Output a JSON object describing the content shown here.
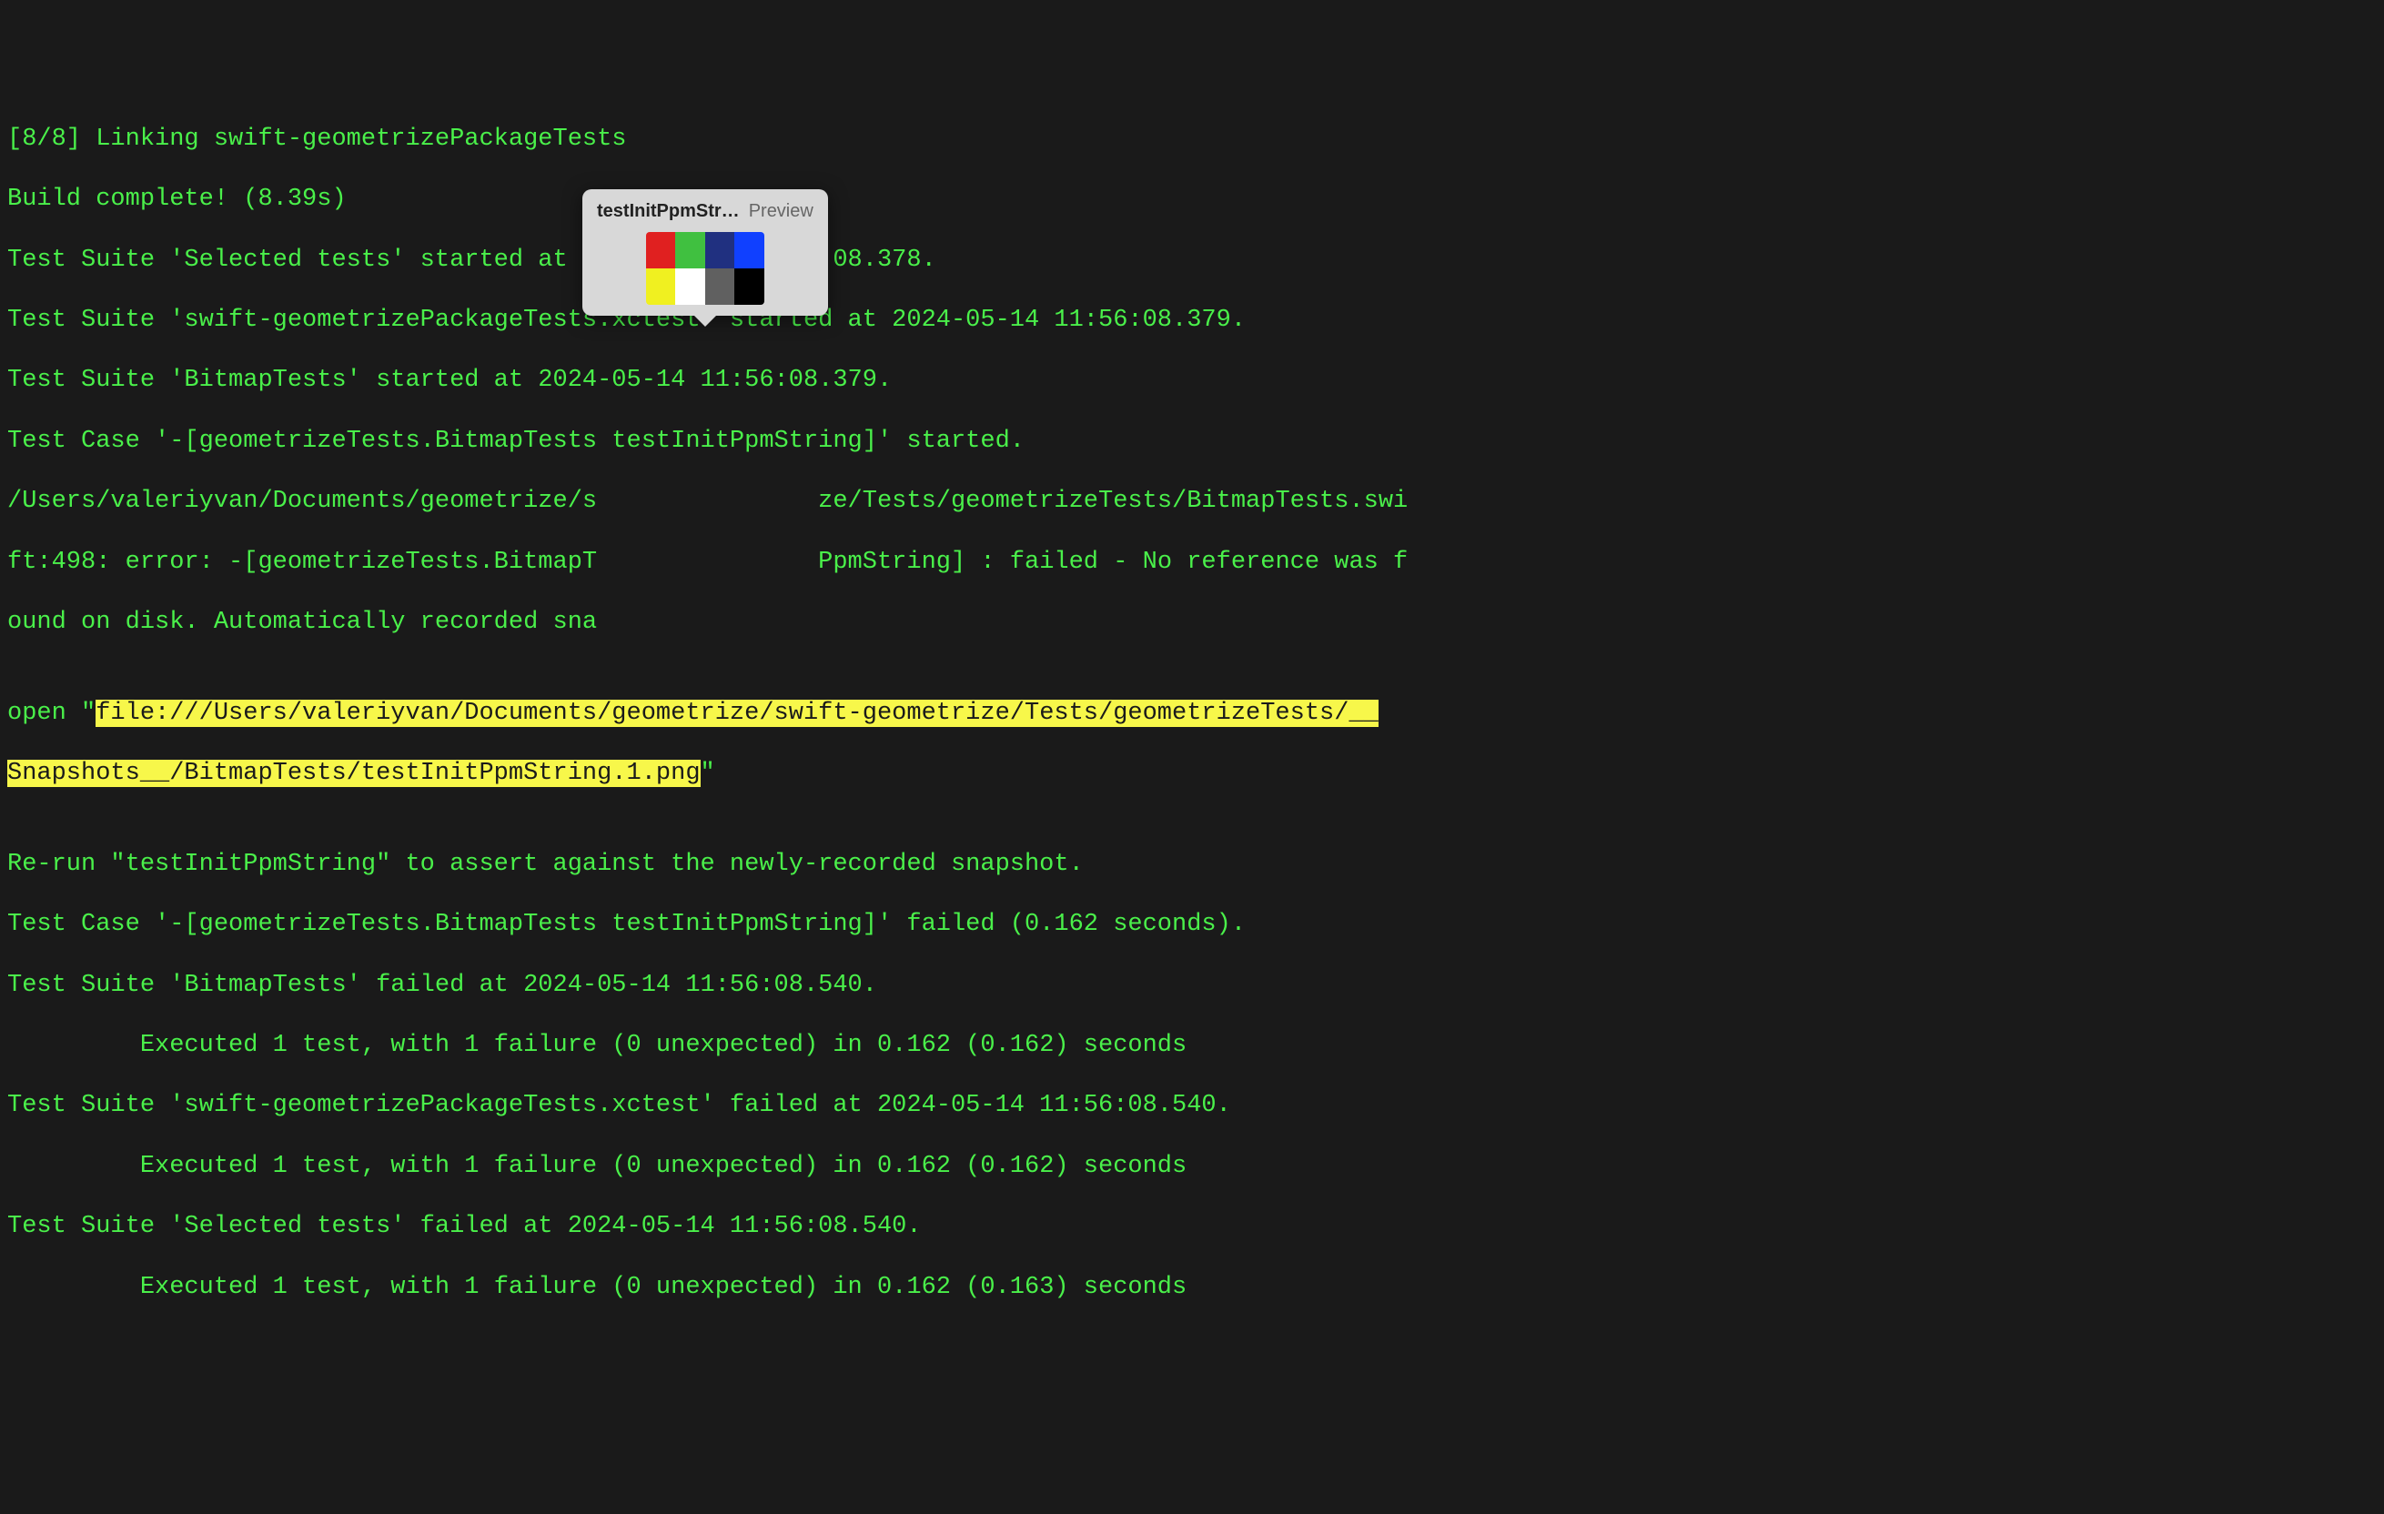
{
  "lines": {
    "l1": "[8/8] Linking swift-geometrizePackageTests",
    "l2": "Build complete! (8.39s)",
    "l3": "Test Suite 'Selected tests' started at 2024-05-14 11:56:08.378.",
    "l4": "Test Suite 'swift-geometrizePackageTests.xctest' started at 2024-05-14 11:56:08.379.",
    "l5": "Test Suite 'BitmapTests' started at 2024-05-14 11:56:08.379.",
    "l6": "Test Case '-[geometrizeTests.BitmapTests testInitPpmString]' started.",
    "l7_pre": "/Users/valeriyvan/Documents/geometrize/s",
    "l7_post": "ze/Tests/geometrizeTests/BitmapTests.swi",
    "l8_pre": "ft:498: error: -[geometrizeTests.BitmapT",
    "l8_post": "PpmString] : failed - No reference was f",
    "l9_pre": "ound on disk. Automatically recorded sna",
    "l10": "",
    "l11_pre": "open \"",
    "l11_hl": "file:///Users/valeriyvan/Documents/geometrize/swift-geometrize/Tests/geometrizeTests/__",
    "l12_hl": "Snapshots__/BitmapTests/testInitPpmString.1.png",
    "l12_post": "\"",
    "l13": "",
    "l14": "Re-run \"testInitPpmString\" to assert against the newly-recorded snapshot.",
    "l15": "Test Case '-[geometrizeTests.BitmapTests testInitPpmString]' failed (0.162 seconds).",
    "l16": "Test Suite 'BitmapTests' failed at 2024-05-14 11:56:08.540.",
    "l17": "\t Executed 1 test, with 1 failure (0 unexpected) in 0.162 (0.162) seconds",
    "l18": "Test Suite 'swift-geometrizePackageTests.xctest' failed at 2024-05-14 11:56:08.540.",
    "l19": "\t Executed 1 test, with 1 failure (0 unexpected) in 0.162 (0.162) seconds",
    "l20": "Test Suite 'Selected tests' failed at 2024-05-14 11:56:08.540.",
    "l21": "\t Executed 1 test, with 1 failure (0 unexpected) in 0.162 (0.163) seconds"
  },
  "preview": {
    "filename": "testInitPpmStr…",
    "app": "Preview"
  }
}
